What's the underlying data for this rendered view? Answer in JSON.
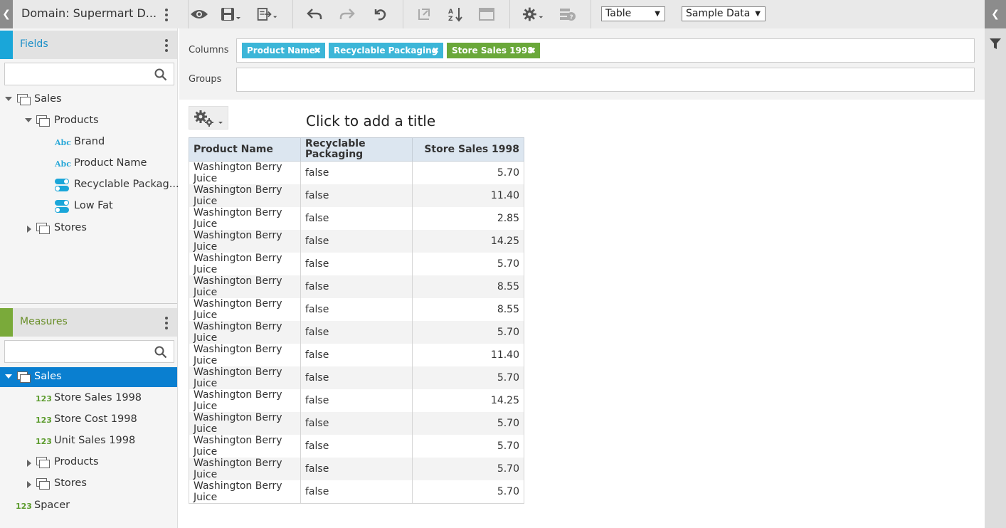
{
  "domain": {
    "title": "Domain: Supermart D..."
  },
  "fields": {
    "label": "Fields",
    "search_value": "",
    "tree": [
      {
        "label": "Sales"
      },
      {
        "label": "Products"
      },
      {
        "label": "Brand",
        "type": "Abc"
      },
      {
        "label": "Product Name",
        "type": "Abc"
      },
      {
        "label": "Recyclable Packag..."
      },
      {
        "label": "Low Fat"
      },
      {
        "label": "Stores"
      }
    ]
  },
  "measures": {
    "label": "Measures",
    "search_value": "",
    "tree": [
      {
        "label": "Sales"
      },
      {
        "label": "Store Sales 1998",
        "type": "123"
      },
      {
        "label": "Store Cost 1998",
        "type": "123"
      },
      {
        "label": "Unit Sales 1998",
        "type": "123"
      },
      {
        "label": "Products"
      },
      {
        "label": "Stores"
      },
      {
        "label": "Spacer",
        "type": "123"
      }
    ]
  },
  "toolbar": {
    "view_type": "Table",
    "data_mode": "Sample Data"
  },
  "columns": {
    "label": "Columns",
    "pills": [
      {
        "label": "Product Name",
        "color": "#3cb6d8"
      },
      {
        "label": "Recyclable Packaging",
        "color": "#3cb6d8"
      },
      {
        "label": "Store Sales 1998",
        "color": "#6aa83a"
      }
    ],
    "remove_glyph": "✖"
  },
  "groups": {
    "label": "Groups"
  },
  "report": {
    "title": "Click to add a title"
  },
  "table": {
    "headers": [
      "Product Name",
      "Recyclable Packaging",
      "Store Sales 1998"
    ],
    "rows": [
      [
        "Washington Berry Juice",
        "false",
        "5.70"
      ],
      [
        "Washington Berry Juice",
        "false",
        "11.40"
      ],
      [
        "Washington Berry Juice",
        "false",
        "2.85"
      ],
      [
        "Washington Berry Juice",
        "false",
        "14.25"
      ],
      [
        "Washington Berry Juice",
        "false",
        "5.70"
      ],
      [
        "Washington Berry Juice",
        "false",
        "8.55"
      ],
      [
        "Washington Berry Juice",
        "false",
        "8.55"
      ],
      [
        "Washington Berry Juice",
        "false",
        "5.70"
      ],
      [
        "Washington Berry Juice",
        "false",
        "11.40"
      ],
      [
        "Washington Berry Juice",
        "false",
        "5.70"
      ],
      [
        "Washington Berry Juice",
        "false",
        "14.25"
      ],
      [
        "Washington Berry Juice",
        "false",
        "5.70"
      ],
      [
        "Washington Berry Juice",
        "false",
        "5.70"
      ],
      [
        "Washington Berry Juice",
        "false",
        "5.70"
      ],
      [
        "Washington Berry Juice",
        "false",
        "5.70"
      ]
    ]
  },
  "colors": {
    "fields_accent": "#1aa6d9",
    "measures_accent": "#7aaa3a",
    "selected_row": "#0a7fd0",
    "header_bg": "#dce6f0"
  }
}
